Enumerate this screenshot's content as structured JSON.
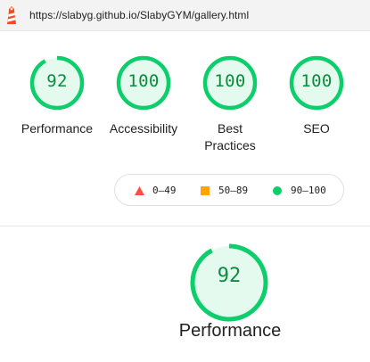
{
  "address_bar": {
    "url": "https://slabyg.github.io/SlabyGYM/gallery.html",
    "icon": "lighthouse-icon"
  },
  "gauges": [
    {
      "score": "92",
      "label": "Performance",
      "fraction": 0.92
    },
    {
      "score": "100",
      "label": "Accessibility",
      "fraction": 1.0
    },
    {
      "score": "100",
      "label": "Best Practices",
      "fraction": 1.0
    },
    {
      "score": "100",
      "label": "SEO",
      "fraction": 1.0
    }
  ],
  "legend": {
    "fail": "0–49",
    "average": "50–89",
    "pass": "90–100"
  },
  "summary": {
    "score": "92",
    "label": "Performance",
    "fraction": 0.92
  },
  "colors": {
    "pass": "#0cce6b",
    "pass_text": "#0c8b3e",
    "pass_bg": "#e5faef",
    "average": "#ffa400",
    "fail": "#ff4e42"
  }
}
